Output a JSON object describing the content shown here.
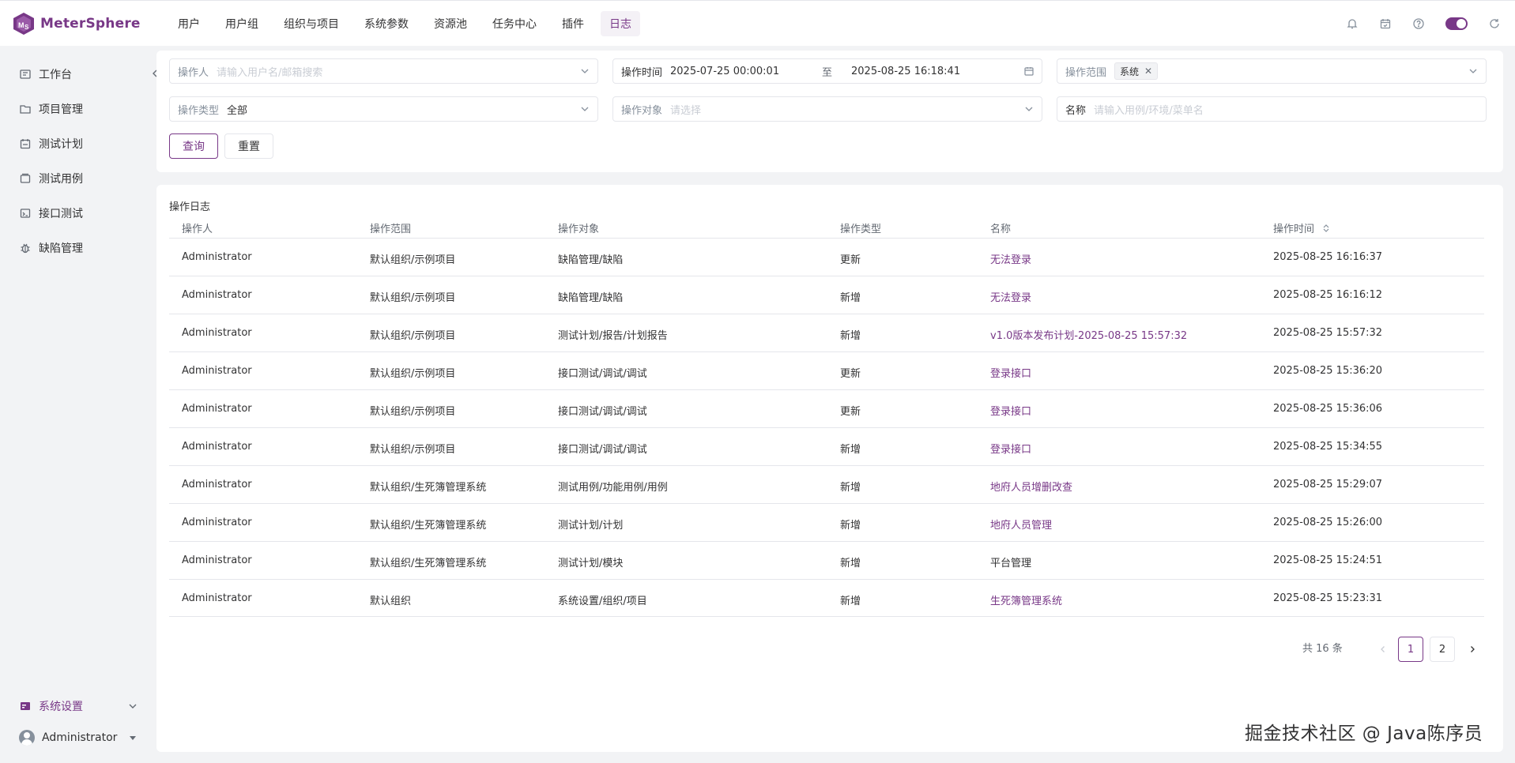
{
  "app": {
    "name": "MeterSphere"
  },
  "colors": {
    "accent": "#783887",
    "border": "#e5e6eb",
    "muted": "#86909c",
    "background": "#f2f3f5"
  },
  "topnav": {
    "items": [
      {
        "label": "用户"
      },
      {
        "label": "用户组"
      },
      {
        "label": "组织与项目"
      },
      {
        "label": "系统参数"
      },
      {
        "label": "资源池"
      },
      {
        "label": "任务中心"
      },
      {
        "label": "插件"
      },
      {
        "label": "日志",
        "active": true
      }
    ],
    "right_icons": [
      "bell-icon",
      "calendar-check-icon",
      "help-icon",
      "theme-toggle",
      "refresh-icon"
    ]
  },
  "sidebar": {
    "items": [
      {
        "label": "工作台",
        "icon": "workbench-icon"
      },
      {
        "label": "项目管理",
        "icon": "project-icon"
      },
      {
        "label": "测试计划",
        "icon": "test-plan-icon"
      },
      {
        "label": "测试用例",
        "icon": "test-case-icon"
      },
      {
        "label": "接口测试",
        "icon": "api-test-icon"
      },
      {
        "label": "缺陷管理",
        "icon": "bug-icon"
      }
    ],
    "settings_label": "系统设置",
    "user_label": "Administrator"
  },
  "filters": {
    "operator": {
      "label": "操作人",
      "placeholder": "请输入用户名/邮箱搜索"
    },
    "time": {
      "label": "操作时间",
      "start": "2025-07-25 00:00:01",
      "separator": "至",
      "end": "2025-08-25 16:18:41"
    },
    "scope": {
      "label": "操作范围",
      "tag": "系统"
    },
    "type": {
      "label": "操作类型",
      "value": "全部"
    },
    "object": {
      "label": "操作对象",
      "placeholder": "请选择"
    },
    "name": {
      "label": "名称",
      "placeholder": "请输入用例/环境/菜单名"
    },
    "query_button": "查询",
    "reset_button": "重置"
  },
  "table": {
    "title": "操作日志",
    "columns": [
      "操作人",
      "操作范围",
      "操作对象",
      "操作类型",
      "名称",
      "操作时间"
    ],
    "rows": [
      {
        "operator": "Administrator",
        "scope": "默认组织/示例项目",
        "object": "缺陷管理/缺陷",
        "type": "更新",
        "name": "无法登录",
        "name_link": true,
        "time": "2025-08-25 16:16:37"
      },
      {
        "operator": "Administrator",
        "scope": "默认组织/示例项目",
        "object": "缺陷管理/缺陷",
        "type": "新增",
        "name": "无法登录",
        "name_link": true,
        "time": "2025-08-25 16:16:12"
      },
      {
        "operator": "Administrator",
        "scope": "默认组织/示例项目",
        "object": "测试计划/报告/计划报告",
        "type": "新增",
        "name": "v1.0版本发布计划-2025-08-25 15:57:32",
        "name_link": true,
        "time": "2025-08-25 15:57:32"
      },
      {
        "operator": "Administrator",
        "scope": "默认组织/示例项目",
        "object": "接口测试/调试/调试",
        "type": "更新",
        "name": "登录接口",
        "name_link": true,
        "time": "2025-08-25 15:36:20"
      },
      {
        "operator": "Administrator",
        "scope": "默认组织/示例项目",
        "object": "接口测试/调试/调试",
        "type": "更新",
        "name": "登录接口",
        "name_link": true,
        "time": "2025-08-25 15:36:06"
      },
      {
        "operator": "Administrator",
        "scope": "默认组织/示例项目",
        "object": "接口测试/调试/调试",
        "type": "新增",
        "name": "登录接口",
        "name_link": true,
        "time": "2025-08-25 15:34:55"
      },
      {
        "operator": "Administrator",
        "scope": "默认组织/生死簿管理系统",
        "object": "测试用例/功能用例/用例",
        "type": "新增",
        "name": "地府人员增删改查",
        "name_link": true,
        "time": "2025-08-25 15:29:07"
      },
      {
        "operator": "Administrator",
        "scope": "默认组织/生死簿管理系统",
        "object": "测试计划/计划",
        "type": "新增",
        "name": "地府人员管理",
        "name_link": true,
        "time": "2025-08-25 15:26:00"
      },
      {
        "operator": "Administrator",
        "scope": "默认组织/生死簿管理系统",
        "object": "测试计划/模块",
        "type": "新增",
        "name": "平台管理",
        "name_link": false,
        "time": "2025-08-25 15:24:51"
      },
      {
        "operator": "Administrator",
        "scope": "默认组织",
        "object": "系统设置/组织/项目",
        "type": "新增",
        "name": "生死簿管理系统",
        "name_link": true,
        "time": "2025-08-25 15:23:31"
      }
    ]
  },
  "pagination": {
    "total_text": "共 16 条",
    "pages": [
      "1",
      "2"
    ],
    "current": "1"
  },
  "watermark": "掘金技术社区 @ Java陈序员"
}
